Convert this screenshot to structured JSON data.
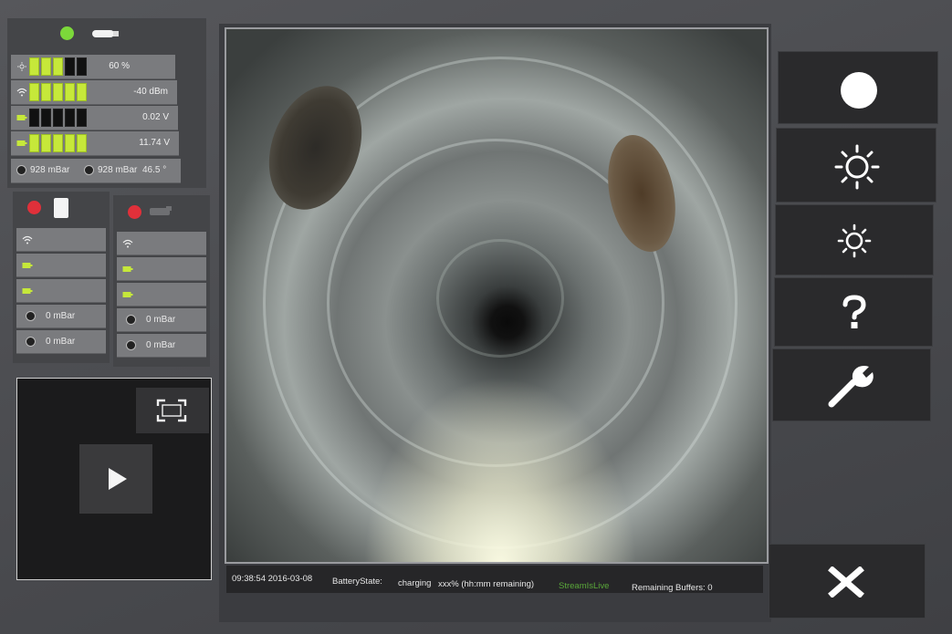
{
  "status": {
    "brightness": {
      "icon": "sun-icon",
      "value": "60 %",
      "level": 3,
      "max": 5
    },
    "wifi": {
      "icon": "wifi-icon",
      "value": "-40 dBm",
      "level": 5,
      "max": 5
    },
    "battery1": {
      "icon": "battery-icon",
      "value": "0.02 V",
      "level": 0,
      "max": 5
    },
    "battery2": {
      "icon": "battery-icon",
      "value": "11.74 V",
      "level": 5,
      "max": 5
    },
    "pressure": {
      "p1": "928 mBar",
      "p2": "928 mBar",
      "angle": "46.5 °"
    }
  },
  "device_a": {
    "indicator_color": "#e0303a",
    "p1": "0 mBar",
    "p2": "0 mBar"
  },
  "device_b": {
    "indicator_color": "#e0303a",
    "p1": "0 mBar",
    "p2": "0 mBar"
  },
  "statusbar": {
    "timestamp": "09:38:54 2016-03-08",
    "battery_label": "BatteryState:",
    "battery_value": "charging",
    "remaining": "xxx% (hh:mm remaining)",
    "stream": "StreamIsLive",
    "buffers": "Remaining Buffers: 0"
  },
  "colors": {
    "ok": "#7cd83a",
    "alert": "#e0303a",
    "bar_on": "#c6e83a",
    "stream_live": "#5aa83a"
  }
}
